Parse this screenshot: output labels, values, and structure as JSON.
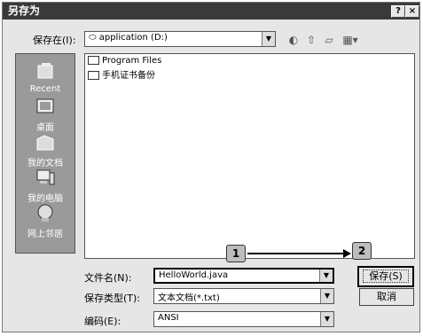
{
  "window": {
    "title": "另存为",
    "help_glyph": "?",
    "close_glyph": "×"
  },
  "save_in": {
    "label": "保存在(I):",
    "value": "application (D:)"
  },
  "toolbar": {
    "back": "◐",
    "up": "⇧",
    "new_folder": "▱",
    "views": "▦▾"
  },
  "places": [
    {
      "label": "Recent",
      "icon": "recent-icon"
    },
    {
      "label": "桌面",
      "icon": "desktop-icon"
    },
    {
      "label": "我的文档",
      "icon": "my-documents-icon"
    },
    {
      "label": "我的电脑",
      "icon": "my-computer-icon"
    },
    {
      "label": "网上邻居",
      "icon": "network-icon"
    }
  ],
  "files": [
    {
      "name": "Program Files"
    },
    {
      "name": "手机证书备份"
    }
  ],
  "filename": {
    "label": "文件名(N):",
    "value": "HelloWorld.java"
  },
  "filetype": {
    "label": "保存类型(T):",
    "value": "文本文档(*.txt)"
  },
  "encoding": {
    "label": "编码(E):",
    "value": "ANSI"
  },
  "buttons": {
    "save": "保存(S)",
    "cancel": "取消"
  },
  "callouts": {
    "one": "1",
    "two": "2"
  }
}
